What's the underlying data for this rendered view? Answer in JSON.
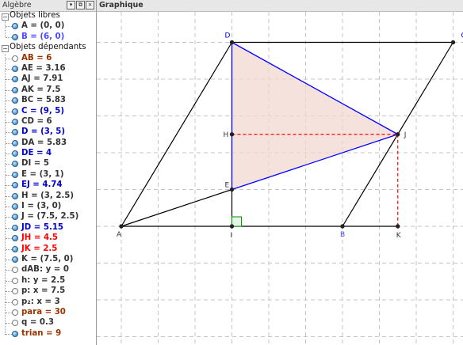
{
  "algebra": {
    "title": "Algèbre",
    "window_buttons": [
      "▾",
      "⧉",
      "×"
    ],
    "groups": [
      {
        "label": "Objets libres",
        "items": [
          {
            "text": "A = (0, 0)",
            "color": "#333333",
            "visible": true
          },
          {
            "text": "B = (6, 0)",
            "color": "#4a4aff",
            "visible": true
          }
        ]
      },
      {
        "label": "Objets dépendants",
        "items": [
          {
            "text": "AB = 6",
            "color": "#993300",
            "visible": false
          },
          {
            "text": "AE = 3.16",
            "color": "#333333",
            "visible": true
          },
          {
            "text": "AJ = 7.91",
            "color": "#333333",
            "visible": true
          },
          {
            "text": "AK = 7.5",
            "color": "#333333",
            "visible": true
          },
          {
            "text": "BC = 5.83",
            "color": "#333333",
            "visible": true
          },
          {
            "text": "C = (9, 5)",
            "color": "#0000cc",
            "visible": true
          },
          {
            "text": "CD = 6",
            "color": "#333333",
            "visible": true
          },
          {
            "text": "D = (3, 5)",
            "color": "#0000cc",
            "visible": true
          },
          {
            "text": "DA = 5.83",
            "color": "#333333",
            "visible": true
          },
          {
            "text": "DE = 4",
            "color": "#0000cc",
            "visible": true
          },
          {
            "text": "DI = 5",
            "color": "#333333",
            "visible": true
          },
          {
            "text": "E = (3, 1)",
            "color": "#333333",
            "visible": true
          },
          {
            "text": "EJ = 4.74",
            "color": "#0000cc",
            "visible": true
          },
          {
            "text": "H = (3, 2.5)",
            "color": "#333333",
            "visible": true
          },
          {
            "text": "I = (3, 0)",
            "color": "#333333",
            "visible": true
          },
          {
            "text": "J = (7.5, 2.5)",
            "color": "#333333",
            "visible": true
          },
          {
            "text": "JD = 5.15",
            "color": "#0000cc",
            "visible": true
          },
          {
            "text": "JH = 4.5",
            "color": "#ff0000",
            "visible": true
          },
          {
            "text": "JK = 2.5",
            "color": "#ff0000",
            "visible": true
          },
          {
            "text": "K = (7.5, 0)",
            "color": "#333333",
            "visible": true
          },
          {
            "text": "dAB: y = 0",
            "color": "#333333",
            "visible": false
          },
          {
            "text": "h: y = 2.5",
            "color": "#333333",
            "visible": false
          },
          {
            "text": "p: x = 7.5",
            "color": "#333333",
            "visible": false
          },
          {
            "text": "p₂: x = 3",
            "color": "#333333",
            "visible": false
          },
          {
            "text": "para = 30",
            "color": "#993300",
            "visible": false
          },
          {
            "text": "q = 0.3",
            "color": "#333333",
            "visible": false
          },
          {
            "text": "trian = 9",
            "color": "#993300",
            "visible": true
          }
        ]
      }
    ]
  },
  "graphics": {
    "title": "Graphique",
    "points": [
      {
        "name": "A",
        "x": 0,
        "y": 0,
        "label_color": "#333333"
      },
      {
        "name": "B",
        "x": 6,
        "y": 0,
        "label_color": "#4a4aff"
      },
      {
        "name": "C",
        "x": 9,
        "y": 5,
        "label_color": "#0000cc"
      },
      {
        "name": "D",
        "x": 3,
        "y": 5,
        "label_color": "#0000cc"
      },
      {
        "name": "E",
        "x": 3,
        "y": 1,
        "label_color": "#333333"
      },
      {
        "name": "H",
        "x": 3,
        "y": 2.5,
        "label_color": "#333333"
      },
      {
        "name": "I",
        "x": 3,
        "y": 0,
        "label_color": "#333333"
      },
      {
        "name": "J",
        "x": 7.5,
        "y": 2.5,
        "label_color": "#333333"
      },
      {
        "name": "K",
        "x": 7.5,
        "y": 0,
        "label_color": "#333333"
      }
    ],
    "colors": {
      "black": "#000000",
      "blue": "#0000ff",
      "red": "#ff0000",
      "fill": "#f2d8d0",
      "grid": "#c4c4c4",
      "right_angle": "#009900"
    }
  }
}
